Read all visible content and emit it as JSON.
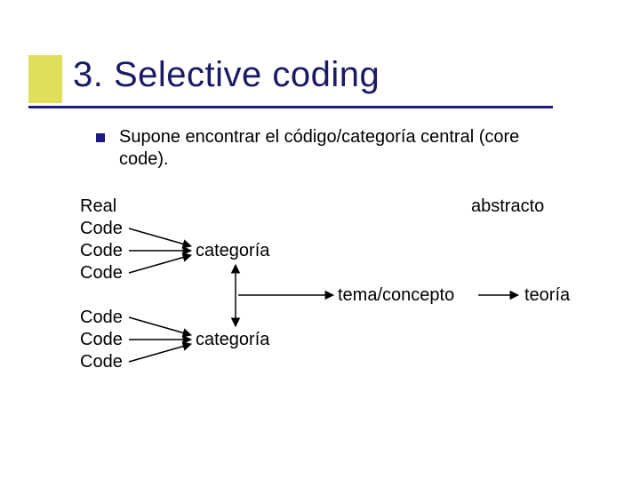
{
  "title": "3. Selective coding",
  "bullet": "Supone encontrar el código/categoría central (core code).",
  "labels": {
    "real": "Real",
    "code1a": "Code",
    "code1b": "Code",
    "code1c": "Code",
    "code2a": "Code",
    "code2b": "Code",
    "code2c": "Code",
    "cat1": "categoría",
    "cat2": "categoría",
    "tema": "tema/concepto",
    "abstracto": "abstracto",
    "teoria": "teoría"
  }
}
